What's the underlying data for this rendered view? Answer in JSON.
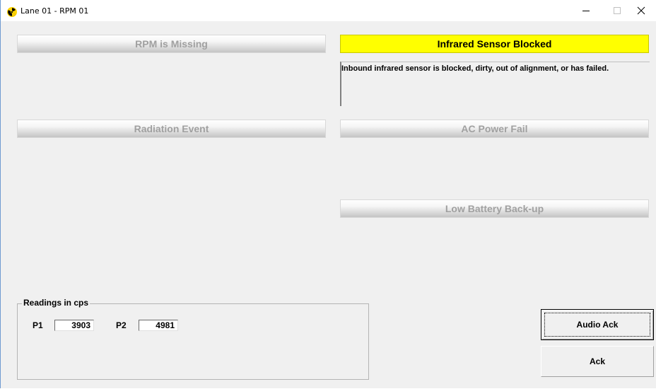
{
  "window": {
    "title": "Lane 01 - RPM 01",
    "controls": {
      "minimize": "minimize-icon",
      "maximize": "maximize-icon",
      "close": "close-icon"
    }
  },
  "alarms": {
    "rpm_missing": {
      "label": "RPM is Missing",
      "active": false
    },
    "infrared_blocked": {
      "label": "Infrared Sensor Blocked",
      "active": true,
      "description": "Inbound infrared sensor is blocked, dirty, out of alignment, or has failed."
    },
    "radiation_event": {
      "label": "Radiation Event",
      "active": false
    },
    "ac_power_fail": {
      "label": "AC Power Fail",
      "active": false
    },
    "low_battery": {
      "label": "Low Battery Back-up",
      "active": false
    }
  },
  "readings": {
    "title": "Readings in cps",
    "p1": {
      "label": "P1",
      "value": "3903"
    },
    "p2": {
      "label": "P2",
      "value": "4981"
    }
  },
  "buttons": {
    "audio_ack": "Audio Ack",
    "ack": "Ack"
  },
  "colors": {
    "alarm_active": "#ffff00",
    "inactive_text": "#a0a0a0",
    "window_bg": "#f0f0f0"
  },
  "icons": {
    "app": "radiation-icon"
  }
}
